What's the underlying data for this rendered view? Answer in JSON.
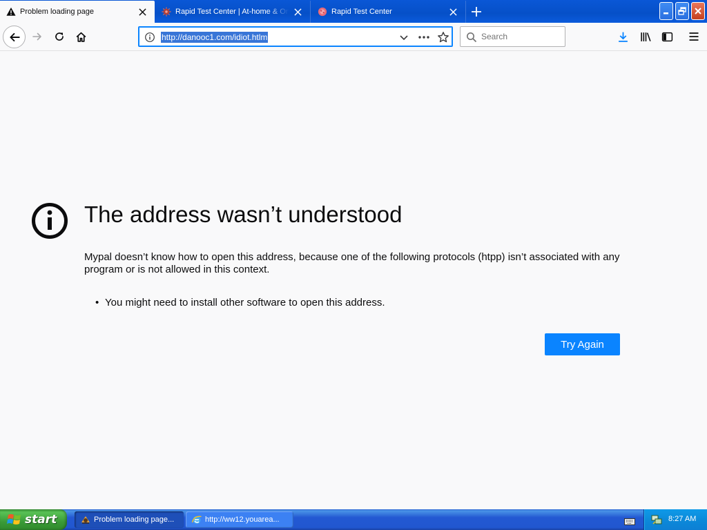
{
  "tabs": [
    {
      "title": "Problem loading page",
      "active": true,
      "icon": "warning-icon"
    },
    {
      "title": "Rapid Test Center | At-home & On",
      "active": false,
      "icon": "virus-favicon-icon"
    },
    {
      "title": "Rapid Test Center",
      "active": false,
      "icon": "virus-favicon-icon"
    }
  ],
  "toolbar": {
    "url": "http://danooc1.com/idiot.htlm",
    "search_placeholder": "Search"
  },
  "error_page": {
    "title": "The address wasn’t understood",
    "description": "Mypal doesn’t know how to open this address, because one of the following protocols (htpp) isn’t associated with any program or is not allowed in this context.",
    "bullet_1": "You might need to install other software to open this address.",
    "bullet_char": "•",
    "button_label": "Try Again"
  },
  "taskbar": {
    "start_label": "start",
    "tasks": [
      {
        "label": "Problem loading page...",
        "icon": "mypal-icon",
        "active": true
      },
      {
        "label": "http://ww12.youarea...",
        "icon": "ie-icon",
        "active": false
      }
    ],
    "clock": "8:27 AM"
  },
  "colors": {
    "accent": "#0a84ff",
    "titlebar": "#0a57d6",
    "page_bg": "#f9f9fa",
    "text": "#0c0c0d",
    "start_green": "#3b9b38",
    "close_red": "#c5401f"
  }
}
